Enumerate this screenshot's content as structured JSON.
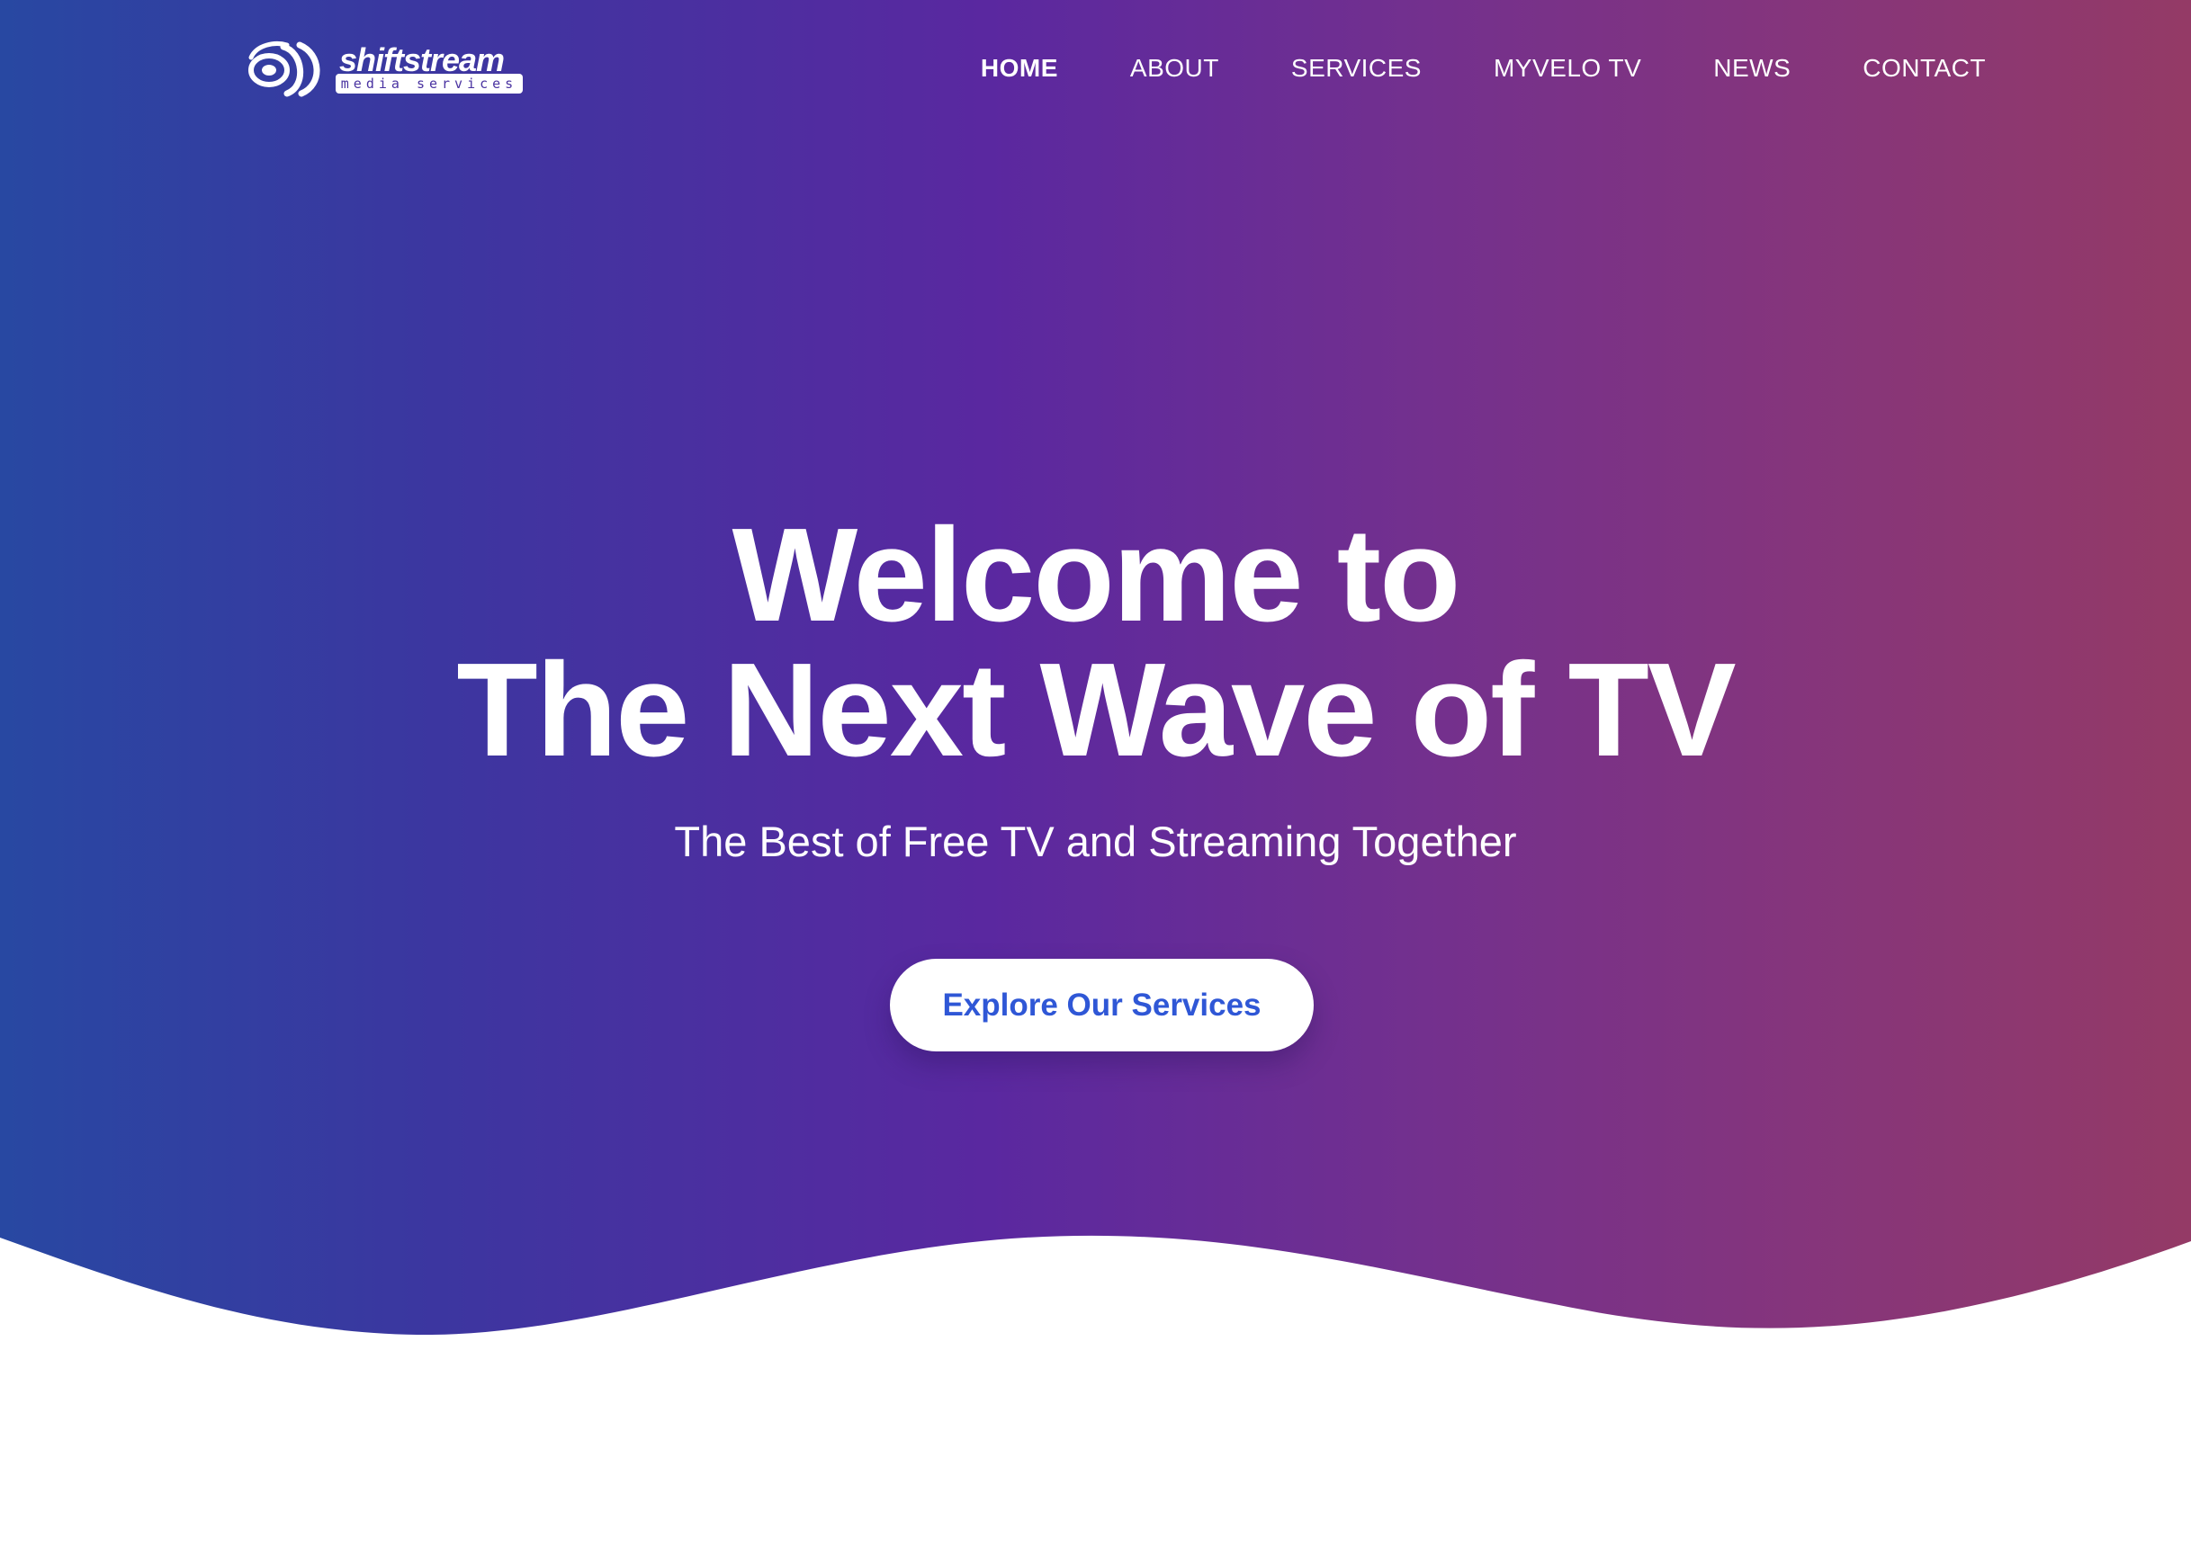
{
  "brand": {
    "name": "shiftstream",
    "tagline": "media services",
    "logo_icon": "stream-waves-icon"
  },
  "nav": {
    "items": [
      {
        "label": "HOME",
        "active": true
      },
      {
        "label": "ABOUT",
        "active": false
      },
      {
        "label": "SERVICES",
        "active": false
      },
      {
        "label": "MYVELO TV",
        "active": false
      },
      {
        "label": "NEWS",
        "active": false
      },
      {
        "label": "CONTACT",
        "active": false
      }
    ]
  },
  "hero": {
    "headline_line1": "Welcome to",
    "headline_line2": "The Next Wave of TV",
    "subtitle": "The Best of Free TV and Streaming Together",
    "cta_label": "Explore Our Services"
  },
  "colors": {
    "gradient_start": "#2848a2",
    "gradient_mid": "#5a28a0",
    "gradient_end": "#943a66",
    "cta_text": "#2f57d6",
    "background": "#ffffff"
  }
}
